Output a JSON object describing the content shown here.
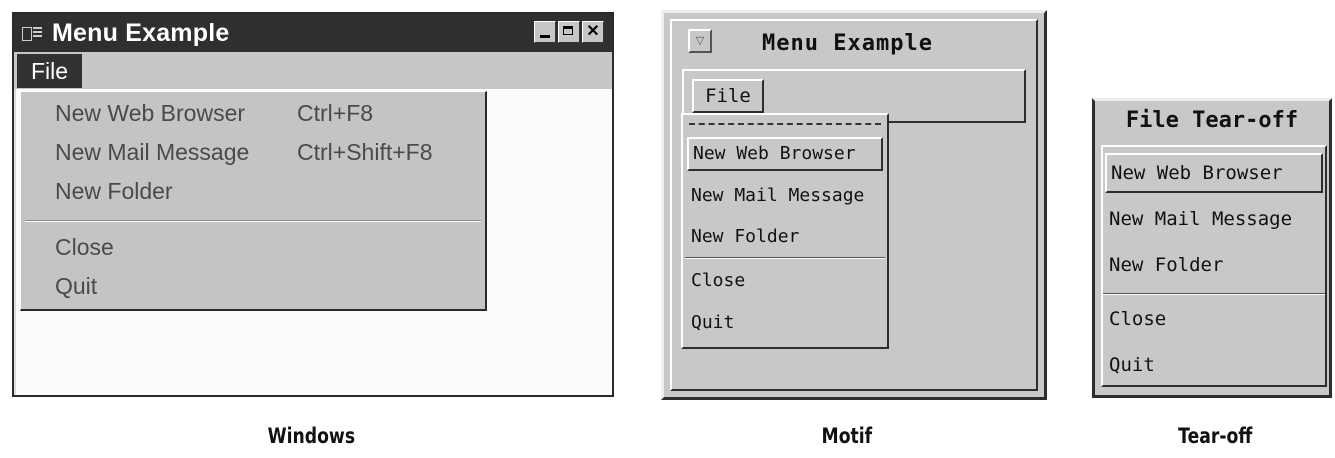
{
  "windows": {
    "title": "Menu Example",
    "menu_label": "File",
    "items": [
      {
        "label": "New Web Browser",
        "accel": "Ctrl+F8"
      },
      {
        "label": "New Mail Message",
        "accel": "Ctrl+Shift+F8"
      },
      {
        "label": "New Folder",
        "accel": ""
      },
      {
        "label": "Close",
        "accel": ""
      },
      {
        "label": "Quit",
        "accel": ""
      }
    ],
    "caption": "Windows"
  },
  "motif": {
    "title": "Menu Example",
    "menu_label": "File",
    "items": [
      "New Web Browser",
      "New Mail Message",
      "New Folder",
      "Close",
      "Quit"
    ],
    "caption": "Motif"
  },
  "tearoff": {
    "title": "File Tear-off",
    "items": [
      "New Web Browser",
      "New Mail Message",
      "New Folder",
      "Close",
      "Quit"
    ],
    "caption": "Tear-off"
  },
  "colors": {
    "windows_titlebar": "#2f2f2f",
    "menu_gray": "#c6c6c6"
  },
  "icons": [
    "system-menu-icon",
    "minimize-icon",
    "maximize-icon",
    "close-icon",
    "window-menu-icon"
  ]
}
